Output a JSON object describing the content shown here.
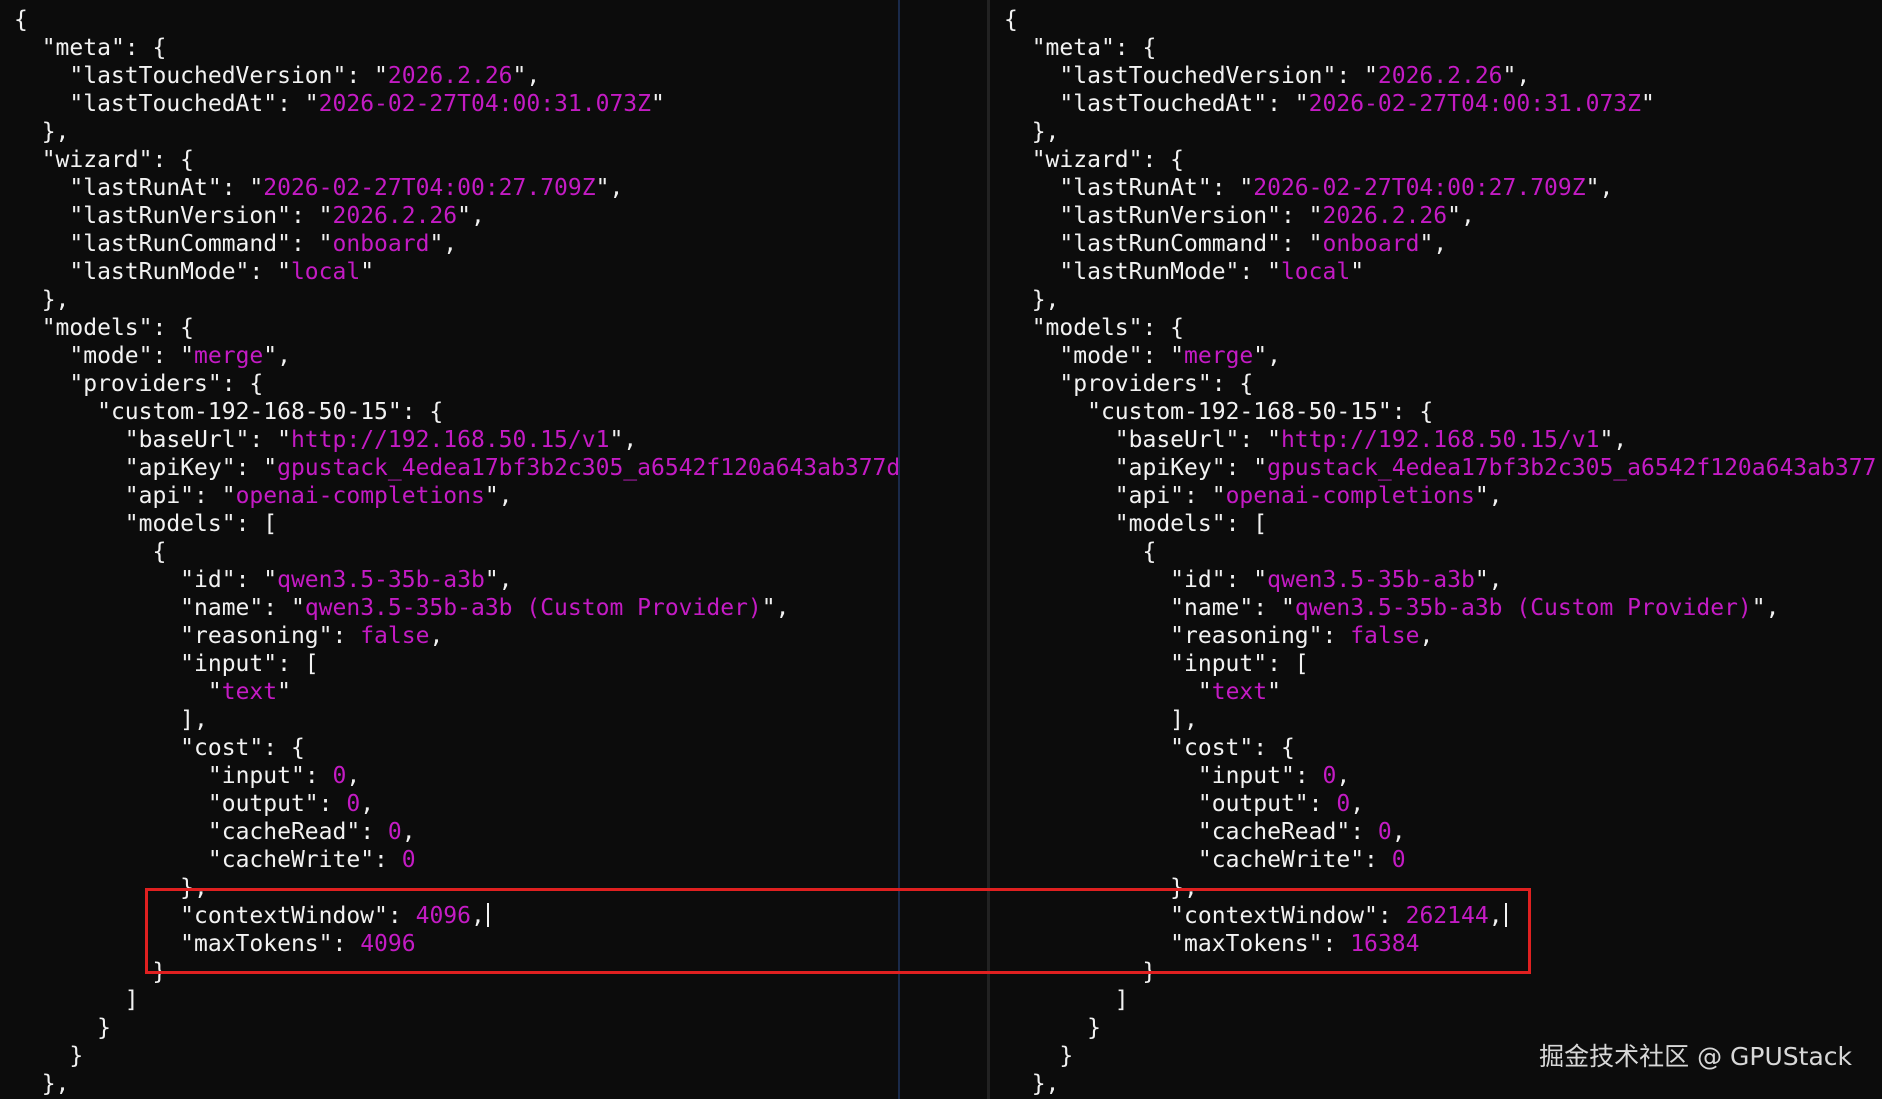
{
  "watermark": "掘金技术社区 @ GPUStack",
  "colors": {
    "background": "#0c0c0c",
    "key": "#f2f2f2",
    "string": "#c41bc4",
    "highlight": "#e02020"
  },
  "left": {
    "lines": [
      [
        [
          "p",
          "{"
        ]
      ],
      [
        [
          "p",
          "  "
        ],
        [
          "k",
          "\"meta\""
        ],
        [
          "p",
          ": {"
        ]
      ],
      [
        [
          "p",
          "    "
        ],
        [
          "k",
          "\"lastTouchedVersion\""
        ],
        [
          "p",
          ": \""
        ],
        [
          "s",
          "2026.2.26"
        ],
        [
          "p",
          "\","
        ]
      ],
      [
        [
          "p",
          "    "
        ],
        [
          "k",
          "\"lastTouchedAt\""
        ],
        [
          "p",
          ": \""
        ],
        [
          "s",
          "2026-02-27T04:00:31.073Z"
        ],
        [
          "p",
          "\""
        ]
      ],
      [
        [
          "p",
          "  },"
        ]
      ],
      [
        [
          "p",
          "  "
        ],
        [
          "k",
          "\"wizard\""
        ],
        [
          "p",
          ": {"
        ]
      ],
      [
        [
          "p",
          "    "
        ],
        [
          "k",
          "\"lastRunAt\""
        ],
        [
          "p",
          ": \""
        ],
        [
          "s",
          "2026-02-27T04:00:27.709Z"
        ],
        [
          "p",
          "\","
        ]
      ],
      [
        [
          "p",
          "    "
        ],
        [
          "k",
          "\"lastRunVersion\""
        ],
        [
          "p",
          ": \""
        ],
        [
          "s",
          "2026.2.26"
        ],
        [
          "p",
          "\","
        ]
      ],
      [
        [
          "p",
          "    "
        ],
        [
          "k",
          "\"lastRunCommand\""
        ],
        [
          "p",
          ": \""
        ],
        [
          "s",
          "onboard"
        ],
        [
          "p",
          "\","
        ]
      ],
      [
        [
          "p",
          "    "
        ],
        [
          "k",
          "\"lastRunMode\""
        ],
        [
          "p",
          ": \""
        ],
        [
          "s",
          "local"
        ],
        [
          "p",
          "\""
        ]
      ],
      [
        [
          "p",
          "  },"
        ]
      ],
      [
        [
          "p",
          "  "
        ],
        [
          "k",
          "\"models\""
        ],
        [
          "p",
          ": {"
        ]
      ],
      [
        [
          "p",
          "    "
        ],
        [
          "k",
          "\"mode\""
        ],
        [
          "p",
          ": \""
        ],
        [
          "s",
          "merge"
        ],
        [
          "p",
          "\","
        ]
      ],
      [
        [
          "p",
          "    "
        ],
        [
          "k",
          "\"providers\""
        ],
        [
          "p",
          ": {"
        ]
      ],
      [
        [
          "p",
          "      "
        ],
        [
          "k",
          "\"custom-192-168-50-15\""
        ],
        [
          "p",
          ": {"
        ]
      ],
      [
        [
          "p",
          "        "
        ],
        [
          "k",
          "\"baseUrl\""
        ],
        [
          "p",
          ": \""
        ],
        [
          "s",
          "http://192.168.50.15/v1"
        ],
        [
          "p",
          "\","
        ]
      ],
      [
        [
          "p",
          "        "
        ],
        [
          "k",
          "\"apiKey\""
        ],
        [
          "p",
          ": \""
        ],
        [
          "s",
          "gpustack_4edea17bf3b2c305_a6542f120a643ab377d"
        ]
      ],
      [
        [
          "p",
          "        "
        ],
        [
          "k",
          "\"api\""
        ],
        [
          "p",
          ": \""
        ],
        [
          "s",
          "openai-completions"
        ],
        [
          "p",
          "\","
        ]
      ],
      [
        [
          "p",
          "        "
        ],
        [
          "k",
          "\"models\""
        ],
        [
          "p",
          ": ["
        ]
      ],
      [
        [
          "p",
          "          {"
        ]
      ],
      [
        [
          "p",
          "            "
        ],
        [
          "k",
          "\"id\""
        ],
        [
          "p",
          ": \""
        ],
        [
          "s",
          "qwen3.5-35b-a3b"
        ],
        [
          "p",
          "\","
        ]
      ],
      [
        [
          "p",
          "            "
        ],
        [
          "k",
          "\"name\""
        ],
        [
          "p",
          ": \""
        ],
        [
          "s",
          "qwen3.5-35b-a3b (Custom Provider)"
        ],
        [
          "p",
          "\","
        ]
      ],
      [
        [
          "p",
          "            "
        ],
        [
          "k",
          "\"reasoning\""
        ],
        [
          "p",
          ": "
        ],
        [
          "n",
          "false"
        ],
        [
          "p",
          ","
        ]
      ],
      [
        [
          "p",
          "            "
        ],
        [
          "k",
          "\"input\""
        ],
        [
          "p",
          ": ["
        ]
      ],
      [
        [
          "p",
          "              \""
        ],
        [
          "s",
          "text"
        ],
        [
          "p",
          "\""
        ]
      ],
      [
        [
          "p",
          "            ],"
        ]
      ],
      [
        [
          "p",
          "            "
        ],
        [
          "k",
          "\"cost\""
        ],
        [
          "p",
          ": {"
        ]
      ],
      [
        [
          "p",
          "              "
        ],
        [
          "k",
          "\"input\""
        ],
        [
          "p",
          ": "
        ],
        [
          "n",
          "0"
        ],
        [
          "p",
          ","
        ]
      ],
      [
        [
          "p",
          "              "
        ],
        [
          "k",
          "\"output\""
        ],
        [
          "p",
          ": "
        ],
        [
          "n",
          "0"
        ],
        [
          "p",
          ","
        ]
      ],
      [
        [
          "p",
          "              "
        ],
        [
          "k",
          "\"cacheRead\""
        ],
        [
          "p",
          ": "
        ],
        [
          "n",
          "0"
        ],
        [
          "p",
          ","
        ]
      ],
      [
        [
          "p",
          "              "
        ],
        [
          "k",
          "\"cacheWrite\""
        ],
        [
          "p",
          ": "
        ],
        [
          "n",
          "0"
        ]
      ],
      [
        [
          "p",
          "            },"
        ]
      ],
      [
        [
          "p",
          "            "
        ],
        [
          "k",
          "\"contextWindow\""
        ],
        [
          "p",
          ": "
        ],
        [
          "n",
          "4096"
        ],
        [
          "p",
          ","
        ],
        [
          "c",
          ""
        ]
      ],
      [
        [
          "p",
          "            "
        ],
        [
          "k",
          "\"maxTokens\""
        ],
        [
          "p",
          ": "
        ],
        [
          "n",
          "4096"
        ]
      ],
      [
        [
          "p",
          "          }"
        ]
      ],
      [
        [
          "p",
          "        ]"
        ]
      ],
      [
        [
          "p",
          "      }"
        ]
      ],
      [
        [
          "p",
          "    }"
        ]
      ],
      [
        [
          "p",
          "  },"
        ]
      ]
    ]
  },
  "right": {
    "lines": [
      [
        [
          "p",
          "{"
        ]
      ],
      [
        [
          "p",
          "  "
        ],
        [
          "k",
          "\"meta\""
        ],
        [
          "p",
          ": {"
        ]
      ],
      [
        [
          "p",
          "    "
        ],
        [
          "k",
          "\"lastTouchedVersion\""
        ],
        [
          "p",
          ": \""
        ],
        [
          "s",
          "2026.2.26"
        ],
        [
          "p",
          "\","
        ]
      ],
      [
        [
          "p",
          "    "
        ],
        [
          "k",
          "\"lastTouchedAt\""
        ],
        [
          "p",
          ": \""
        ],
        [
          "s",
          "2026-02-27T04:00:31.073Z"
        ],
        [
          "p",
          "\""
        ]
      ],
      [
        [
          "p",
          "  },"
        ]
      ],
      [
        [
          "p",
          "  "
        ],
        [
          "k",
          "\"wizard\""
        ],
        [
          "p",
          ": {"
        ]
      ],
      [
        [
          "p",
          "    "
        ],
        [
          "k",
          "\"lastRunAt\""
        ],
        [
          "p",
          ": \""
        ],
        [
          "s",
          "2026-02-27T04:00:27.709Z"
        ],
        [
          "p",
          "\","
        ]
      ],
      [
        [
          "p",
          "    "
        ],
        [
          "k",
          "\"lastRunVersion\""
        ],
        [
          "p",
          ": \""
        ],
        [
          "s",
          "2026.2.26"
        ],
        [
          "p",
          "\","
        ]
      ],
      [
        [
          "p",
          "    "
        ],
        [
          "k",
          "\"lastRunCommand\""
        ],
        [
          "p",
          ": \""
        ],
        [
          "s",
          "onboard"
        ],
        [
          "p",
          "\","
        ]
      ],
      [
        [
          "p",
          "    "
        ],
        [
          "k",
          "\"lastRunMode\""
        ],
        [
          "p",
          ": \""
        ],
        [
          "s",
          "local"
        ],
        [
          "p",
          "\""
        ]
      ],
      [
        [
          "p",
          "  },"
        ]
      ],
      [
        [
          "p",
          "  "
        ],
        [
          "k",
          "\"models\""
        ],
        [
          "p",
          ": {"
        ]
      ],
      [
        [
          "p",
          "    "
        ],
        [
          "k",
          "\"mode\""
        ],
        [
          "p",
          ": \""
        ],
        [
          "s",
          "merge"
        ],
        [
          "p",
          "\","
        ]
      ],
      [
        [
          "p",
          "    "
        ],
        [
          "k",
          "\"providers\""
        ],
        [
          "p",
          ": {"
        ]
      ],
      [
        [
          "p",
          "      "
        ],
        [
          "k",
          "\"custom-192-168-50-15\""
        ],
        [
          "p",
          ": {"
        ]
      ],
      [
        [
          "p",
          "        "
        ],
        [
          "k",
          "\"baseUrl\""
        ],
        [
          "p",
          ": \""
        ],
        [
          "s",
          "http://192.168.50.15/v1"
        ],
        [
          "p",
          "\","
        ]
      ],
      [
        [
          "p",
          "        "
        ],
        [
          "k",
          "\"apiKey\""
        ],
        [
          "p",
          ": \""
        ],
        [
          "s",
          "gpustack_4edea17bf3b2c305_a6542f120a643ab377"
        ]
      ],
      [
        [
          "p",
          "        "
        ],
        [
          "k",
          "\"api\""
        ],
        [
          "p",
          ": \""
        ],
        [
          "s",
          "openai-completions"
        ],
        [
          "p",
          "\","
        ]
      ],
      [
        [
          "p",
          "        "
        ],
        [
          "k",
          "\"models\""
        ],
        [
          "p",
          ": ["
        ]
      ],
      [
        [
          "p",
          "          {"
        ]
      ],
      [
        [
          "p",
          "            "
        ],
        [
          "k",
          "\"id\""
        ],
        [
          "p",
          ": \""
        ],
        [
          "s",
          "qwen3.5-35b-a3b"
        ],
        [
          "p",
          "\","
        ]
      ],
      [
        [
          "p",
          "            "
        ],
        [
          "k",
          "\"name\""
        ],
        [
          "p",
          ": \""
        ],
        [
          "s",
          "qwen3.5-35b-a3b (Custom Provider)"
        ],
        [
          "p",
          "\","
        ]
      ],
      [
        [
          "p",
          "            "
        ],
        [
          "k",
          "\"reasoning\""
        ],
        [
          "p",
          ": "
        ],
        [
          "n",
          "false"
        ],
        [
          "p",
          ","
        ]
      ],
      [
        [
          "p",
          "            "
        ],
        [
          "k",
          "\"input\""
        ],
        [
          "p",
          ": ["
        ]
      ],
      [
        [
          "p",
          "              \""
        ],
        [
          "s",
          "text"
        ],
        [
          "p",
          "\""
        ]
      ],
      [
        [
          "p",
          "            ],"
        ]
      ],
      [
        [
          "p",
          "            "
        ],
        [
          "k",
          "\"cost\""
        ],
        [
          "p",
          ": {"
        ]
      ],
      [
        [
          "p",
          "              "
        ],
        [
          "k",
          "\"input\""
        ],
        [
          "p",
          ": "
        ],
        [
          "n",
          "0"
        ],
        [
          "p",
          ","
        ]
      ],
      [
        [
          "p",
          "              "
        ],
        [
          "k",
          "\"output\""
        ],
        [
          "p",
          ": "
        ],
        [
          "n",
          "0"
        ],
        [
          "p",
          ","
        ]
      ],
      [
        [
          "p",
          "              "
        ],
        [
          "k",
          "\"cacheRead\""
        ],
        [
          "p",
          ": "
        ],
        [
          "n",
          "0"
        ],
        [
          "p",
          ","
        ]
      ],
      [
        [
          "p",
          "              "
        ],
        [
          "k",
          "\"cacheWrite\""
        ],
        [
          "p",
          ": "
        ],
        [
          "n",
          "0"
        ]
      ],
      [
        [
          "p",
          "            },"
        ]
      ],
      [
        [
          "p",
          "            "
        ],
        [
          "k",
          "\"contextWindow\""
        ],
        [
          "p",
          ": "
        ],
        [
          "n",
          "262144"
        ],
        [
          "p",
          ","
        ],
        [
          "c",
          ""
        ]
      ],
      [
        [
          "p",
          "            "
        ],
        [
          "k",
          "\"maxTokens\""
        ],
        [
          "p",
          ": "
        ],
        [
          "n",
          "16384"
        ]
      ],
      [
        [
          "p",
          "          }"
        ]
      ],
      [
        [
          "p",
          "        ]"
        ]
      ],
      [
        [
          "p",
          "      }"
        ]
      ],
      [
        [
          "p",
          "    }"
        ]
      ],
      [
        [
          "p",
          "  },"
        ]
      ]
    ]
  }
}
